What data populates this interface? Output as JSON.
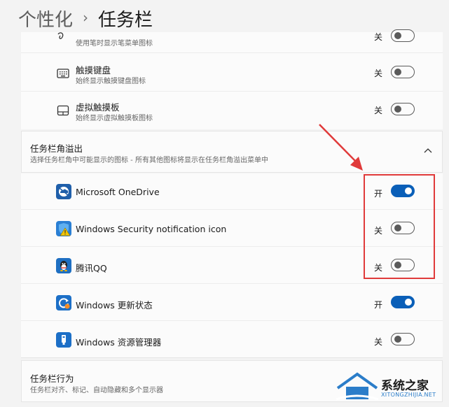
{
  "breadcrumb": {
    "parent": "个性化",
    "separator": "›",
    "current": "任务栏"
  },
  "top_rows": [
    {
      "icon": "pen-icon",
      "subtitle": "使用笔时显示笔菜单图标",
      "state": "关",
      "on": false
    },
    {
      "icon": "touch-keyboard-icon",
      "title": "触摸键盘",
      "subtitle": "始终显示触摸键盘图标",
      "state": "关",
      "on": false
    },
    {
      "icon": "virtual-touchpad-icon",
      "title": "虚拟触摸板",
      "subtitle": "始终显示虚拟触摸板图标",
      "state": "关",
      "on": false
    }
  ],
  "overflow_section": {
    "title": "任务栏角溢出",
    "subtitle": "选择任务栏角中可能显示的图标 - 所有其他图标将显示在任务栏角溢出菜单中",
    "items": [
      {
        "icon": "onedrive-icon",
        "label": "Microsoft OneDrive",
        "state": "开",
        "on": true
      },
      {
        "icon": "windows-security-icon",
        "label": "Windows Security notification icon",
        "state": "关",
        "on": false
      },
      {
        "icon": "qq-icon",
        "label": "腾讯QQ",
        "state": "关",
        "on": false
      },
      {
        "icon": "windows-update-icon",
        "label": "Windows 更新状态",
        "state": "开",
        "on": true
      },
      {
        "icon": "file-explorer-icon",
        "label": "Windows 资源管理器",
        "state": "关",
        "on": false
      }
    ]
  },
  "behavior_section": {
    "title": "任务栏行为",
    "subtitle": "任务栏对齐、标记、自动隐藏和多个显示器"
  },
  "watermark": {
    "title": "系统之家",
    "url": "XITONGZHIJIA.NET"
  },
  "colors": {
    "accent": "#0a5fb8",
    "annotation": "#e03a3a"
  }
}
